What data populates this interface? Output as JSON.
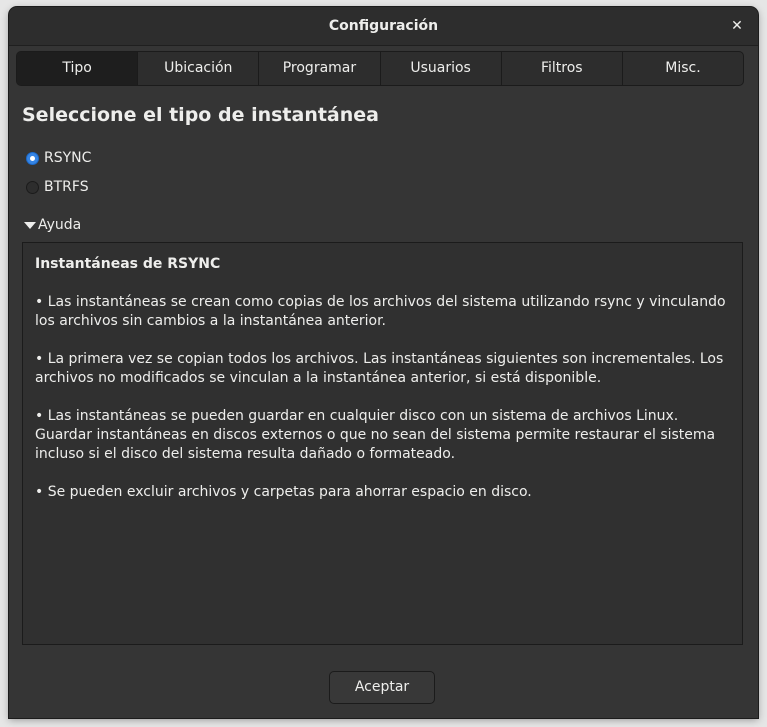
{
  "window": {
    "title": "Configuración",
    "close_glyph": "✕"
  },
  "tabs": [
    {
      "label": "Tipo",
      "active": true
    },
    {
      "label": "Ubicación",
      "active": false
    },
    {
      "label": "Programar",
      "active": false
    },
    {
      "label": "Usuarios",
      "active": false
    },
    {
      "label": "Filtros",
      "active": false
    },
    {
      "label": "Misc.",
      "active": false
    }
  ],
  "main": {
    "heading": "Seleccione el tipo de instantánea",
    "options": [
      {
        "label": "RSYNC",
        "checked": true
      },
      {
        "label": "BTRFS",
        "checked": false
      }
    ],
    "expander_label": "Ayuda",
    "expander_icon": "triangle-down-icon",
    "help": {
      "title": "Instantáneas de RSYNC",
      "paragraphs": [
        "• Las instantáneas se crean como copias de los archivos del sistema utilizando rsync y vinculando los archivos sin cambios a la instantánea anterior.",
        "• La primera vez se copian todos los archivos. Las instantáneas siguientes son incrementales. Los archivos no modificados se vinculan a la instantánea anterior, si está disponible.",
        "• Las instantáneas se pueden guardar en cualquier disco con un sistema de archivos Linux. Guardar instantáneas en discos externos o que no sean del sistema permite restaurar el sistema incluso si el disco del sistema resulta dañado o formateado.",
        "• Se pueden excluir archivos y carpetas para ahorrar espacio en disco."
      ]
    }
  },
  "footer": {
    "accept_label": "Aceptar"
  },
  "colors": {
    "accent": "#3584e4",
    "window_bg": "#353535",
    "text": "#eeeeec"
  }
}
